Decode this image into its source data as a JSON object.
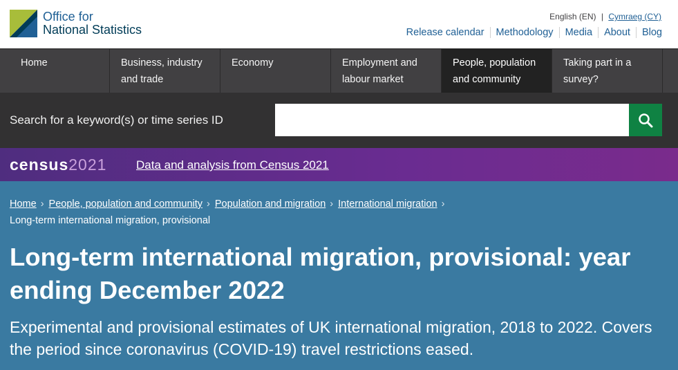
{
  "header": {
    "logo_line1": "Office for",
    "logo_line2": "National Statistics",
    "lang_en": "English (EN)",
    "lang_sep": "|",
    "lang_cy": "Cymraeg (CY)",
    "links": [
      "Release calendar",
      "Methodology",
      "Media",
      "About",
      "Blog"
    ]
  },
  "nav": {
    "items": [
      {
        "line1": "Home",
        "line2": ""
      },
      {
        "line1": "Business, industry",
        "line2": "and trade"
      },
      {
        "line1": "Economy",
        "line2": ""
      },
      {
        "line1": "Employment and",
        "line2": "labour market"
      },
      {
        "line1": "People, population",
        "line2": "and community"
      },
      {
        "line1": "Taking part in a",
        "line2": "survey?"
      }
    ],
    "active_index": 4
  },
  "search": {
    "label": "Search for a keyword(s) or time series ID",
    "value": "",
    "button_icon": "search-icon"
  },
  "census": {
    "word": "census",
    "year": "2021",
    "link": "Data and analysis from Census 2021"
  },
  "breadcrumb": {
    "items": [
      "Home",
      "People, population and community",
      "Population and migration",
      "International migration"
    ],
    "current": "Long-term international migration, provisional"
  },
  "page": {
    "title": "Long-term international migration, provisional: year ending December 2022",
    "subtitle": "Experimental and provisional estimates of UK international migration, 2018 to 2022. Covers the period since coronavirus (COVID-19) travel restrictions eased."
  },
  "colors": {
    "brand_blue": "#206095",
    "nav_bg": "#414042",
    "nav_active": "#222222",
    "search_bg": "#323132",
    "search_button": "#0f8243",
    "census_purple": "#6a2c91",
    "hero_blue": "#3a7aa1"
  }
}
